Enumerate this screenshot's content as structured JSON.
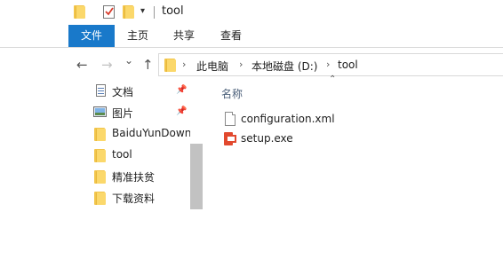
{
  "titlebar": {
    "title": "tool",
    "dropdown": "▾"
  },
  "ribbon": {
    "tabs": [
      "文件",
      "主页",
      "共享",
      "查看"
    ]
  },
  "navigation": {
    "back": "←",
    "forward": "→",
    "recent": "⌄",
    "up": "↑"
  },
  "address": {
    "crumbs": [
      "此电脑",
      "本地磁盘 (D:)",
      "tool"
    ],
    "separator": "›"
  },
  "nav_pane": {
    "items": [
      {
        "label": "文档",
        "icon": "documents-icon",
        "pinned": true
      },
      {
        "label": "图片",
        "icon": "pictures-icon",
        "pinned": true
      },
      {
        "label": "BaiduYunDownload",
        "icon": "folder-icon",
        "pinned": false
      },
      {
        "label": "tool",
        "icon": "folder-icon",
        "pinned": false
      },
      {
        "label": "精准扶贫",
        "icon": "folder-icon",
        "pinned": false
      },
      {
        "label": "下载资料",
        "icon": "folder-icon",
        "pinned": false
      }
    ],
    "pin_glyph": "📌"
  },
  "content": {
    "column_header": "名称",
    "sort_glyph": "⌃",
    "files": [
      {
        "name": "configuration.xml",
        "icon": "xml-file-icon"
      },
      {
        "name": "setup.exe",
        "icon": "office-setup-icon"
      }
    ]
  },
  "colors": {
    "accent": "#1979ca",
    "folder": "#fbd86b",
    "office": "#e2492e"
  }
}
